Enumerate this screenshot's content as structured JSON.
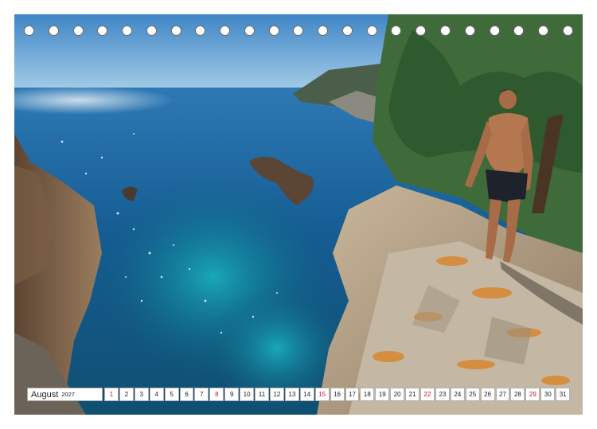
{
  "calendar": {
    "month": "August",
    "year": "2027",
    "days": [
      {
        "n": "1",
        "sunday": true
      },
      {
        "n": "2",
        "sunday": false
      },
      {
        "n": "3",
        "sunday": false
      },
      {
        "n": "4",
        "sunday": false
      },
      {
        "n": "5",
        "sunday": false
      },
      {
        "n": "6",
        "sunday": false
      },
      {
        "n": "7",
        "sunday": false
      },
      {
        "n": "8",
        "sunday": true
      },
      {
        "n": "9",
        "sunday": false
      },
      {
        "n": "10",
        "sunday": false
      },
      {
        "n": "11",
        "sunday": false
      },
      {
        "n": "12",
        "sunday": false
      },
      {
        "n": "13",
        "sunday": false
      },
      {
        "n": "14",
        "sunday": false
      },
      {
        "n": "15",
        "sunday": true
      },
      {
        "n": "16",
        "sunday": false
      },
      {
        "n": "17",
        "sunday": false
      },
      {
        "n": "18",
        "sunday": false
      },
      {
        "n": "19",
        "sunday": false
      },
      {
        "n": "20",
        "sunday": false
      },
      {
        "n": "21",
        "sunday": false
      },
      {
        "n": "22",
        "sunday": true
      },
      {
        "n": "23",
        "sunday": false
      },
      {
        "n": "24",
        "sunday": false
      },
      {
        "n": "25",
        "sunday": false
      },
      {
        "n": "26",
        "sunday": false
      },
      {
        "n": "27",
        "sunday": false
      },
      {
        "n": "28",
        "sunday": false
      },
      {
        "n": "29",
        "sunday": true
      },
      {
        "n": "30",
        "sunday": false
      },
      {
        "n": "31",
        "sunday": false
      }
    ],
    "sunday_color": "#c0192a"
  },
  "binding": {
    "hole_count": 23
  }
}
